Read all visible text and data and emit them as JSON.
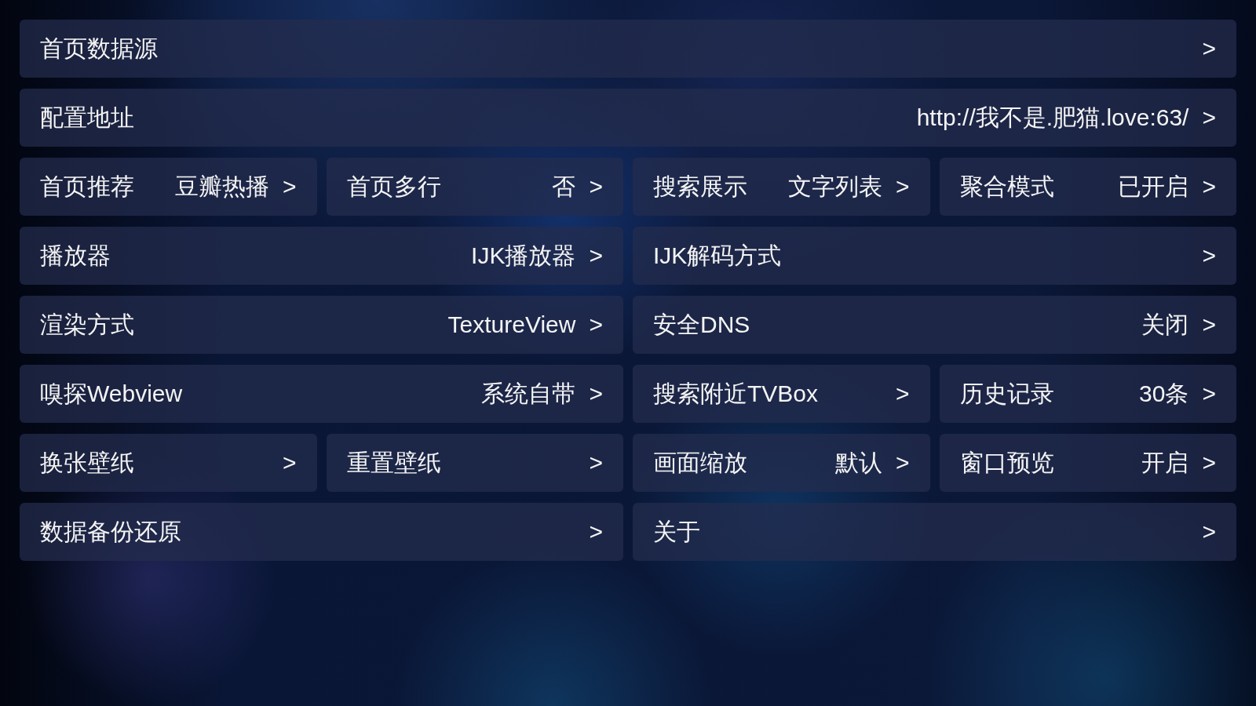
{
  "rows": [
    {
      "groups": [
        {
          "items": [
            {
              "label": "首页数据源",
              "arrow": ">"
            }
          ]
        }
      ]
    },
    {
      "groups": [
        {
          "items": [
            {
              "label": "配置地址",
              "value": "http://我不是.肥猫.love:63/",
              "arrow": ">"
            }
          ]
        }
      ]
    },
    {
      "groups": [
        {
          "items": [
            {
              "label": "首页推荐",
              "value": "豆瓣热播",
              "arrow": ">"
            },
            {
              "label": "首页多行",
              "value": "否",
              "arrow": ">"
            }
          ]
        },
        {
          "items": [
            {
              "label": "搜索展示",
              "value": "文字列表",
              "arrow": ">"
            },
            {
              "label": "聚合模式",
              "value": "已开启",
              "arrow": ">"
            }
          ]
        }
      ]
    },
    {
      "groups": [
        {
          "items": [
            {
              "label": "播放器",
              "value": "IJK播放器",
              "arrow": ">"
            }
          ]
        },
        {
          "items": [
            {
              "label": "IJK解码方式",
              "arrow": ">"
            }
          ]
        }
      ]
    },
    {
      "groups": [
        {
          "items": [
            {
              "label": "渲染方式",
              "value": "TextureView",
              "arrow": ">"
            }
          ]
        },
        {
          "items": [
            {
              "label": "安全DNS",
              "value": "关闭",
              "arrow": ">"
            }
          ]
        }
      ]
    },
    {
      "groups": [
        {
          "items": [
            {
              "label": "嗅探Webview",
              "value": "系统自带",
              "arrow": ">"
            }
          ]
        },
        {
          "items": [
            {
              "label": "搜索附近TVBox",
              "arrow": ">"
            },
            {
              "label": "历史记录",
              "value": "30条",
              "arrow": ">"
            }
          ]
        }
      ]
    },
    {
      "groups": [
        {
          "items": [
            {
              "label": "换张壁纸",
              "arrow": ">"
            },
            {
              "label": "重置壁纸",
              "arrow": ">"
            }
          ]
        },
        {
          "items": [
            {
              "label": "画面缩放",
              "value": "默认",
              "arrow": ">"
            },
            {
              "label": "窗口预览",
              "value": "开启",
              "arrow": ">"
            }
          ]
        }
      ]
    },
    {
      "groups": [
        {
          "items": [
            {
              "label": "数据备份还原",
              "arrow": ">"
            }
          ]
        },
        {
          "items": [
            {
              "label": "关于",
              "arrow": ">"
            }
          ]
        }
      ]
    }
  ]
}
